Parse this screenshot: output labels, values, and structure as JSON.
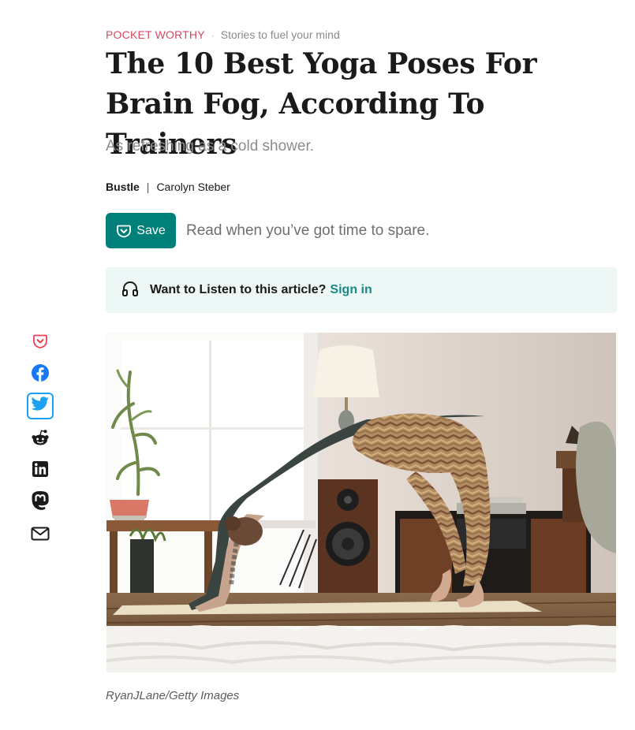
{
  "eyebrow": {
    "brand": "POCKET WORTHY",
    "separator": "·",
    "tagline": "Stories to fuel your mind"
  },
  "article": {
    "title": "The 10 Best Yoga Poses For Brain Fog, According To Trainers",
    "subtitle": "As refreshing as a cold shower.",
    "publisher": "Bustle",
    "byline_separator": "|",
    "author": "Carolyn Steber"
  },
  "save": {
    "label": "Save",
    "hint": "Read when you’ve got time to spare."
  },
  "listen": {
    "prompt": "Want to Listen to this article?",
    "signin_label": "Sign in"
  },
  "share": {
    "items": [
      {
        "icon": "pocket-icon",
        "color": "#ef4056"
      },
      {
        "icon": "facebook-icon",
        "color": "#1877f2"
      },
      {
        "icon": "twitter-icon",
        "color": "#1da1f2",
        "active": true
      },
      {
        "icon": "reddit-icon",
        "color": "#1a1a1a"
      },
      {
        "icon": "linkedin-icon",
        "color": "#1a1a1a"
      },
      {
        "icon": "mastodon-icon",
        "color": "#1a1a1a"
      },
      {
        "icon": "mail-icon",
        "color": "#1a1a1a"
      }
    ]
  },
  "image": {
    "caption": "RyanJLane/Getty Images"
  },
  "colors": {
    "accent": "#008078",
    "brand_red": "#d6475e",
    "listen_bg": "#ecf7f6",
    "signin_link": "#1a8a83"
  }
}
